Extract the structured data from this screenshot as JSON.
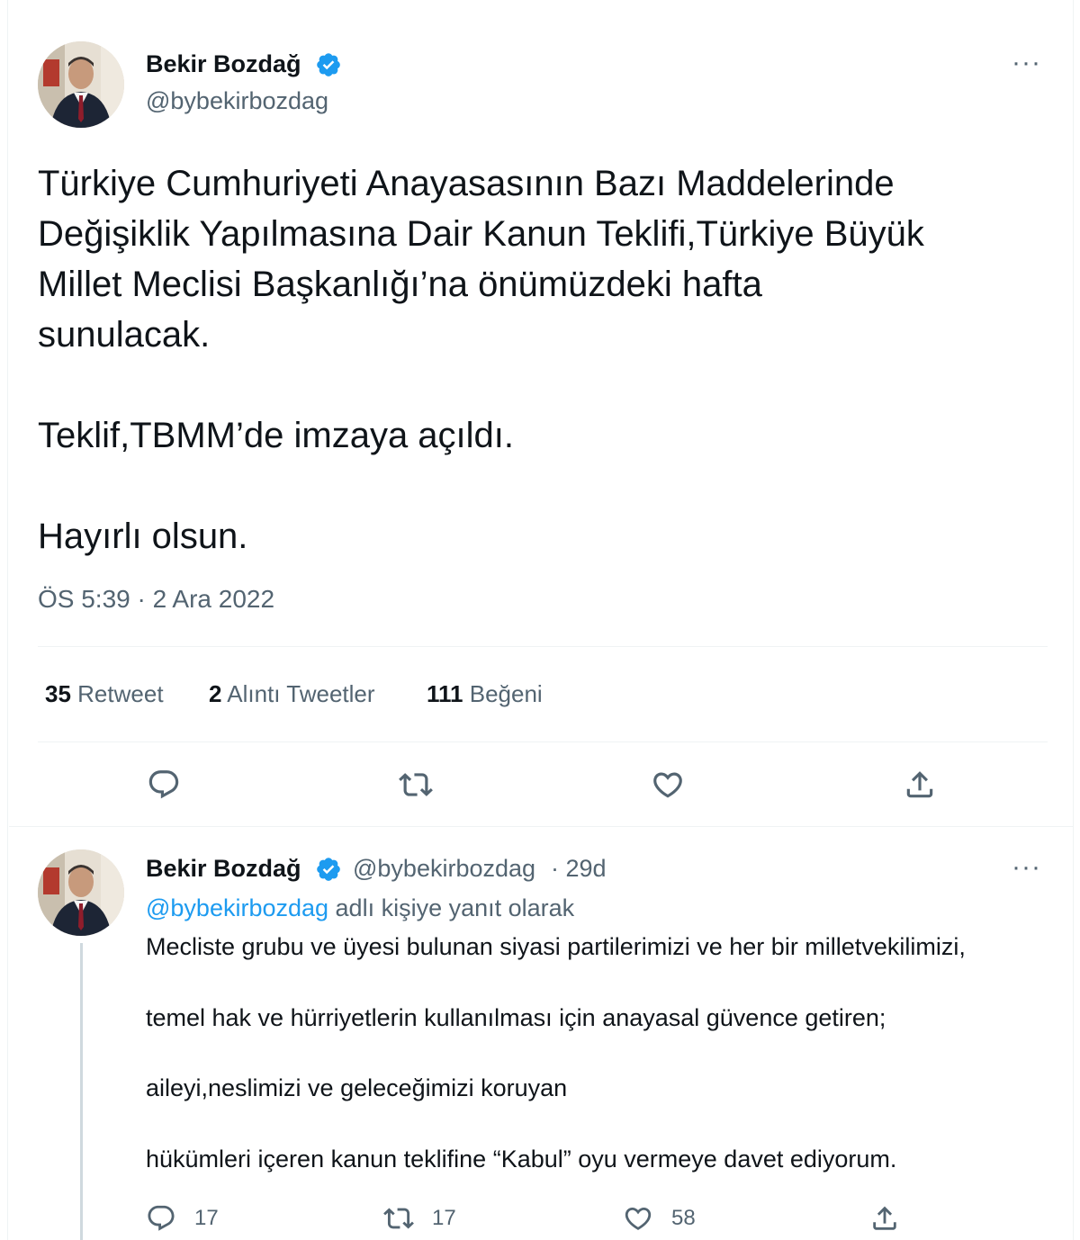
{
  "tweet": {
    "author_name": "Bekir Bozdağ",
    "author_handle": "@bybekirbozdag",
    "more_glyph": "···",
    "text_lines": [
      "Türkiye Cumhuriyeti Anayasasının Bazı Maddelerinde",
      "Değişiklik Yapılmasına Dair Kanun Teklifi,Türkiye Büyük",
      "Millet Meclisi Başkanlığı’na önümüzdeki hafta",
      "sunulacak."
    ],
    "text_para2": "Teklif,TBMM’de imzaya açıldı.",
    "text_para3": "Hayırlı olsun.",
    "timestamp": "ÖS 5:39 · 2 Ara 2022",
    "stats": {
      "retweets_count": "35",
      "retweets_label": "Retweet",
      "quotes_count": "2",
      "quotes_label": "Alıntı Tweetler",
      "likes_count": "111",
      "likes_label": "Beğeni"
    },
    "actions": [
      "reply-icon",
      "retweet-icon",
      "like-icon",
      "share-icon"
    ]
  },
  "reply": {
    "author_name": "Bekir Bozdağ",
    "author_handle": "@bybekirbozdag",
    "age": "· 29d",
    "more_glyph": "···",
    "reply_to_mention": "@bybekirbozdag",
    "reply_to_suffix": " adlı kişiye yanıt olarak",
    "lines": [
      "Mecliste grubu ve üyesi bulunan siyasi partilerimizi ve her bir milletvekilimizi,",
      "temel hak ve hürriyetlerin kullanılması için anayasal güvence getiren;",
      "aileyi,neslimizi ve geleceğimizi koruyan",
      "hükümleri içeren kanun teklifine “Kabul”  oyu vermeye davet ediyorum."
    ],
    "reply_count": "17",
    "retweet_count": "17",
    "like_count": "58"
  },
  "colors": {
    "text": "#0f1419",
    "secondary": "#536471",
    "accent": "#1d9bf0",
    "divider": "#eff3f4"
  }
}
